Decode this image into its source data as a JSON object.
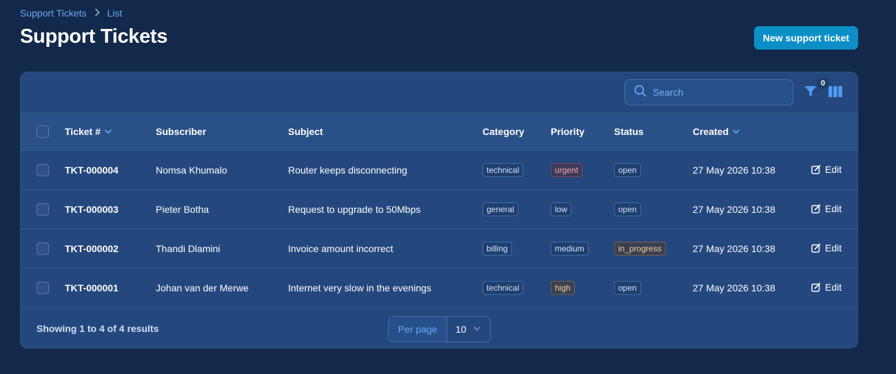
{
  "breadcrumb": {
    "items": [
      "Support Tickets",
      "List"
    ]
  },
  "page_title": "Support Tickets",
  "new_button_label": "New support ticket",
  "search": {
    "placeholder": "Search",
    "value": ""
  },
  "filter_count": "0",
  "table": {
    "headers": {
      "ticket": "Ticket #",
      "subscriber": "Subscriber",
      "subject": "Subject",
      "category": "Category",
      "priority": "Priority",
      "status": "Status",
      "created": "Created"
    },
    "rows": [
      {
        "ticket": "TKT-000004",
        "subscriber": "Nomsa Khumalo",
        "subject": "Router keeps disconnecting",
        "category": "technical",
        "priority": "urgent",
        "status": "open",
        "created": "27 May 2026 10:38",
        "action": "Edit"
      },
      {
        "ticket": "TKT-000003",
        "subscriber": "Pieter Botha",
        "subject": "Request to upgrade to 50Mbps",
        "category": "general",
        "priority": "low",
        "status": "open",
        "created": "27 May 2026 10:38",
        "action": "Edit"
      },
      {
        "ticket": "TKT-000002",
        "subscriber": "Thandi Dlamini",
        "subject": "Invoice amount incorrect",
        "category": "billing",
        "priority": "medium",
        "status": "in_progress",
        "created": "27 May 2026 10:38",
        "action": "Edit"
      },
      {
        "ticket": "TKT-000001",
        "subscriber": "Johan van der Merwe",
        "subject": "Internet very slow in the evenings",
        "category": "technical",
        "priority": "high",
        "status": "open",
        "created": "27 May 2026 10:38",
        "action": "Edit"
      }
    ]
  },
  "footer": {
    "showing": "Showing 1 to 4 of 4 results",
    "per_page_label": "Per page",
    "per_page_value": "10"
  },
  "colors": {
    "background": "#13294b",
    "card": "#24487d",
    "accent": "#0b8fc6",
    "link": "#6aa8f5",
    "badge_urgent": "#f3a6a6",
    "badge_in_progress": "#f5c992"
  }
}
